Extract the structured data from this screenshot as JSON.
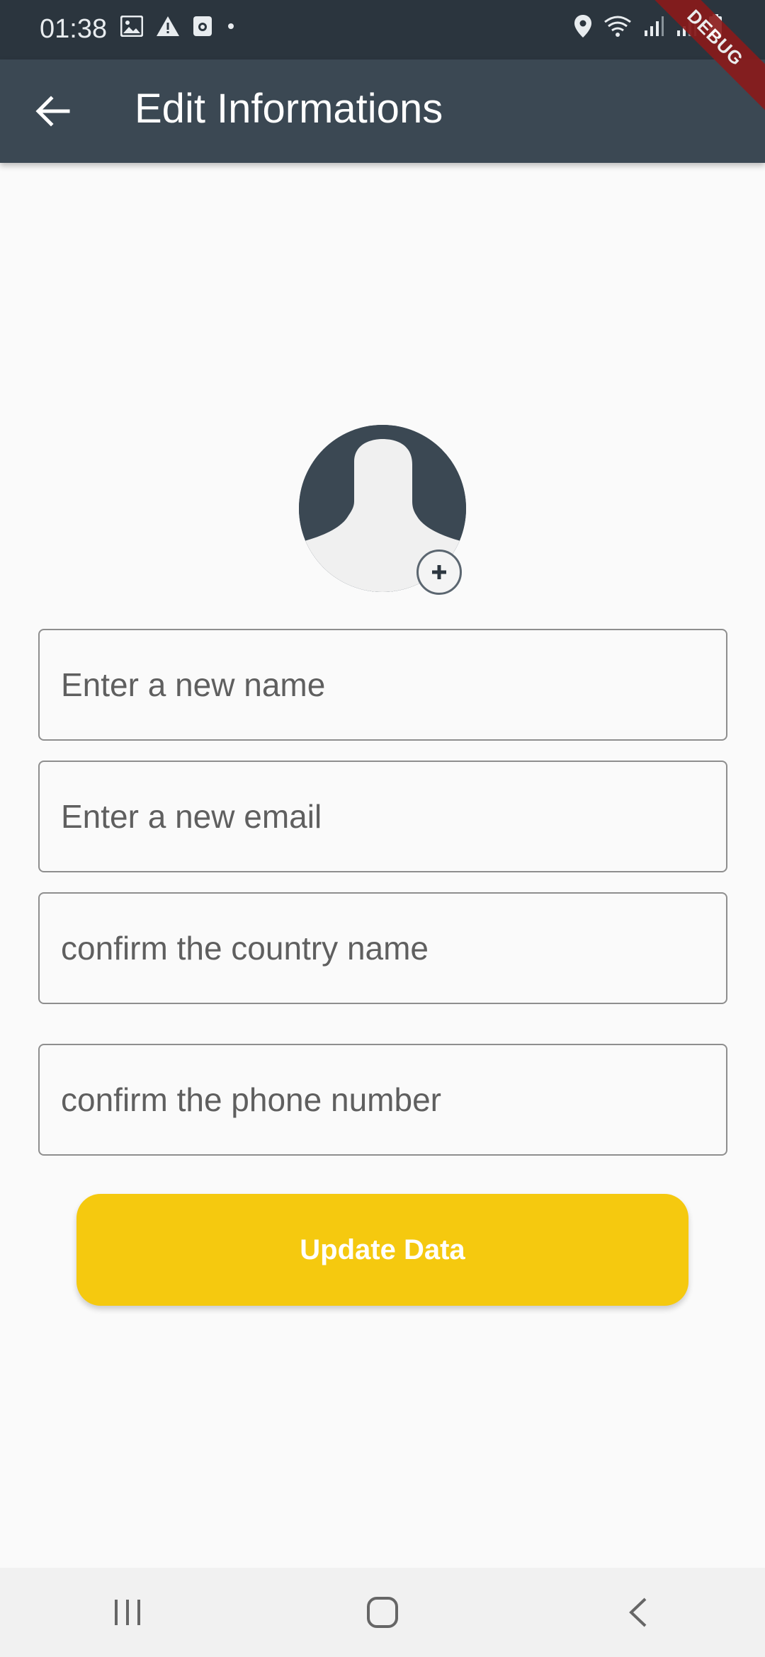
{
  "status_bar": {
    "time": "01:38",
    "left_icons": [
      "image-icon",
      "warning-icon",
      "camera-icon",
      "dot-icon"
    ],
    "right_icons": [
      "location-icon",
      "wifi-icon",
      "signal-icon",
      "signal-icon",
      "battery-icon"
    ]
  },
  "debug_banner": "DEBUG",
  "app_bar": {
    "title": "Edit Informations",
    "back_icon": "arrow-left-icon",
    "background": "#3b4853"
  },
  "avatar": {
    "icon": "person-silhouette-icon",
    "add_icon": "plus-icon"
  },
  "form": {
    "name_placeholder": "Enter a new name",
    "email_placeholder": "Enter a new email",
    "country_placeholder": "confirm the country name",
    "phone_placeholder": "confirm the phone number"
  },
  "update_button": {
    "label": "Update Data",
    "color": "#f5c90f"
  },
  "nav_bar": {
    "recent_icon": "recent-apps-icon",
    "home_icon": "home-icon",
    "back_icon": "back-chevron-icon"
  }
}
